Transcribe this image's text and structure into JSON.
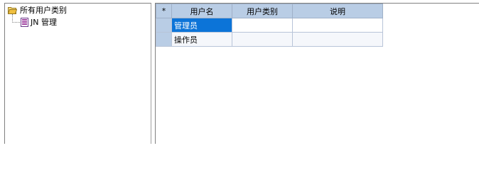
{
  "tree": {
    "root_label": "所有用户类别",
    "child_label": "JN 管理"
  },
  "grid": {
    "corner_label": "*",
    "columns": [
      "用户名",
      "用户类别",
      "说明"
    ],
    "rows": [
      {
        "username": "管理员",
        "category": "",
        "description": ""
      },
      {
        "username": "操作员",
        "category": "",
        "description": ""
      }
    ]
  },
  "colors": {
    "header_bg": "#b9cde5",
    "selected_bg": "#0c74d8",
    "folder": "#f0c040"
  }
}
